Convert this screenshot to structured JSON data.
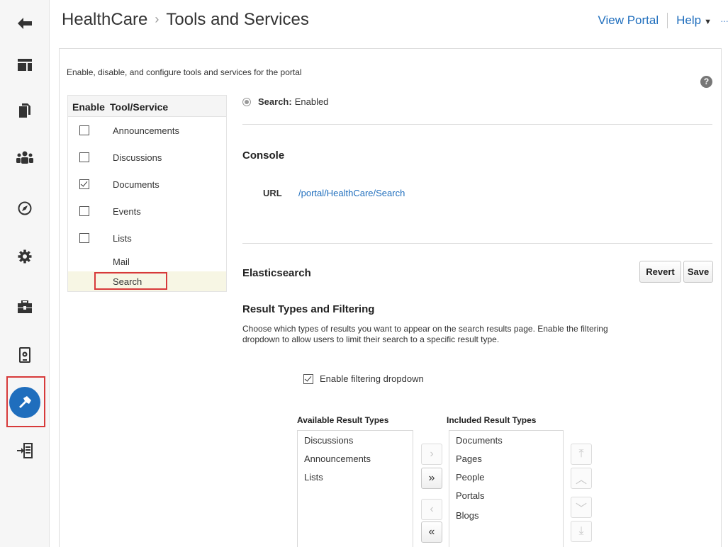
{
  "header": {
    "breadcrumb_root": "HealthCare",
    "breadcrumb_sep": "›",
    "breadcrumb_current": "Tools and Services",
    "view_portal": "View Portal",
    "help": "Help",
    "help_caret": "▼",
    "more": "···"
  },
  "rail": {
    "items": [
      {
        "icon": "back-arrow-icon"
      },
      {
        "icon": "layout-icon"
      },
      {
        "icon": "pages-icon"
      },
      {
        "icon": "members-icon"
      },
      {
        "icon": "compass-icon"
      },
      {
        "icon": "gear-icon"
      },
      {
        "icon": "toolbox-icon"
      },
      {
        "icon": "device-settings-icon"
      },
      {
        "icon": "hammer-icon",
        "active": true
      },
      {
        "icon": "exit-icon"
      }
    ],
    "accent_color": "#1f6ebd",
    "highlight_color": "#d73a3a"
  },
  "panel": {
    "intro": "Enable, disable, and configure tools and services for the portal",
    "help_icon": "?"
  },
  "tools_table": {
    "col_enable": "Enable",
    "col_tool": "Tool/Service",
    "rows": [
      {
        "label": "Announcements",
        "checkbox": true,
        "checked": false
      },
      {
        "label": "Discussions",
        "checkbox": true,
        "checked": false
      },
      {
        "label": "Documents",
        "checkbox": true,
        "checked": true
      },
      {
        "label": "Events",
        "checkbox": true,
        "checked": false
      },
      {
        "label": "Lists",
        "checkbox": true,
        "checked": false
      },
      {
        "label": "Mail",
        "checkbox": false
      },
      {
        "label": "Search",
        "checkbox": false,
        "selected": true
      }
    ]
  },
  "detail": {
    "status_name": "Search:",
    "status_value": "Enabled",
    "console_title": "Console",
    "url_label": "URL",
    "url_value": "/portal/HealthCare/Search",
    "elastic_title": "Elasticsearch",
    "revert_label": "Revert",
    "save_label": "Save",
    "result_title": "Result Types and Filtering",
    "description": "Choose which types of results you want to appear on the search results page. Enable the filtering dropdown to allow users to limit their search to a specific result type.",
    "filter_label": "Enable filtering dropdown",
    "filter_checked": true
  },
  "shuttle": {
    "available_title": "Available Result Types",
    "included_title": "Included Result Types",
    "available": [
      "Discussions",
      "Announcements",
      "Lists"
    ],
    "included": [
      "Documents",
      "Pages",
      "People",
      "Portals",
      "Blogs"
    ],
    "move_one": "›",
    "move_all": "»",
    "remove_one": "‹",
    "remove_all": "«",
    "top": "⤒",
    "up": "︿",
    "down": "﹀",
    "bottom": "⤓"
  }
}
